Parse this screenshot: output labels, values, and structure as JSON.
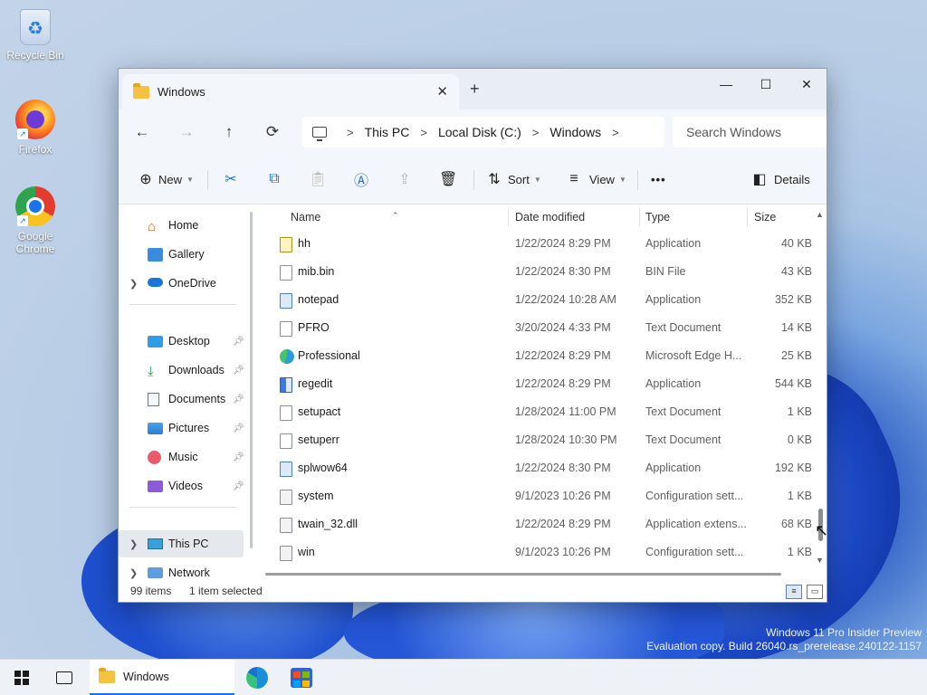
{
  "desktop": {
    "icons": [
      {
        "label": "Recycle Bin"
      },
      {
        "label": "Firefox"
      },
      {
        "label": "Google Chrome"
      }
    ],
    "watermark": {
      "line1": "Windows 11 Pro Insider Preview",
      "line2": "Evaluation copy. Build 26040.rs_prerelease.240122-1157"
    }
  },
  "window": {
    "tab_title": "Windows",
    "tab_close": "✕",
    "new_tab": "+",
    "minimize": "—",
    "maximize": "☐",
    "close": "✕"
  },
  "address": {
    "back": "←",
    "forward": "→",
    "up": "↑",
    "refresh": "⟳",
    "separator": ">",
    "crumbs": [
      "This PC",
      "Local Disk (C:)",
      "Windows"
    ],
    "search_placeholder": "Search Windows"
  },
  "toolbar": {
    "new": "New",
    "sort": "Sort",
    "view": "View",
    "more": "•••",
    "details": "Details"
  },
  "nav": {
    "items": [
      {
        "label": "Home",
        "icon": "home-icon"
      },
      {
        "label": "Gallery",
        "icon": "gallery-icon"
      },
      {
        "label": "OneDrive",
        "icon": "cloud-icon"
      },
      {
        "label": "Desktop",
        "icon": "desktop-icon"
      },
      {
        "label": "Downloads",
        "icon": "download-icon"
      },
      {
        "label": "Documents",
        "icon": "documents-icon"
      },
      {
        "label": "Pictures",
        "icon": "pictures-icon"
      },
      {
        "label": "Music",
        "icon": "music-icon"
      },
      {
        "label": "Videos",
        "icon": "videos-icon"
      },
      {
        "label": "This PC",
        "icon": "pc-icon"
      },
      {
        "label": "Network",
        "icon": "network-icon"
      }
    ]
  },
  "columns": {
    "name": "Name",
    "date": "Date modified",
    "type": "Type",
    "size": "Size"
  },
  "files": [
    {
      "name": "hh",
      "date": "1/22/2024 8:29 PM",
      "type": "Application",
      "size": "40 KB",
      "kind": "hh"
    },
    {
      "name": "mib.bin",
      "date": "1/22/2024 8:30 PM",
      "type": "BIN File",
      "size": "43 KB",
      "kind": "file"
    },
    {
      "name": "notepad",
      "date": "1/22/2024 10:28 AM",
      "type": "Application",
      "size": "352 KB",
      "kind": "app"
    },
    {
      "name": "PFRO",
      "date": "3/20/2024 4:33 PM",
      "type": "Text Document",
      "size": "14 KB",
      "kind": "file"
    },
    {
      "name": "Professional",
      "date": "1/22/2024 8:29 PM",
      "type": "Microsoft Edge H...",
      "size": "25 KB",
      "kind": "edge"
    },
    {
      "name": "regedit",
      "date": "1/22/2024 8:29 PM",
      "type": "Application",
      "size": "544 KB",
      "kind": "reg"
    },
    {
      "name": "setupact",
      "date": "1/28/2024 11:00 PM",
      "type": "Text Document",
      "size": "1 KB",
      "kind": "file"
    },
    {
      "name": "setuperr",
      "date": "1/28/2024 10:30 PM",
      "type": "Text Document",
      "size": "0 KB",
      "kind": "file"
    },
    {
      "name": "splwow64",
      "date": "1/22/2024 8:30 PM",
      "type": "Application",
      "size": "192 KB",
      "kind": "app"
    },
    {
      "name": "system",
      "date": "9/1/2023 10:26 PM",
      "type": "Configuration sett...",
      "size": "1 KB",
      "kind": "cfg"
    },
    {
      "name": "twain_32.dll",
      "date": "1/22/2024 8:29 PM",
      "type": "Application extens...",
      "size": "68 KB",
      "kind": "cfg"
    },
    {
      "name": "win",
      "date": "9/1/2023 10:26 PM",
      "type": "Configuration sett...",
      "size": "1 KB",
      "kind": "cfg"
    }
  ],
  "status": {
    "count": "99 items",
    "selection": "1 item selected"
  },
  "taskbar": {
    "active_label": "Windows"
  }
}
